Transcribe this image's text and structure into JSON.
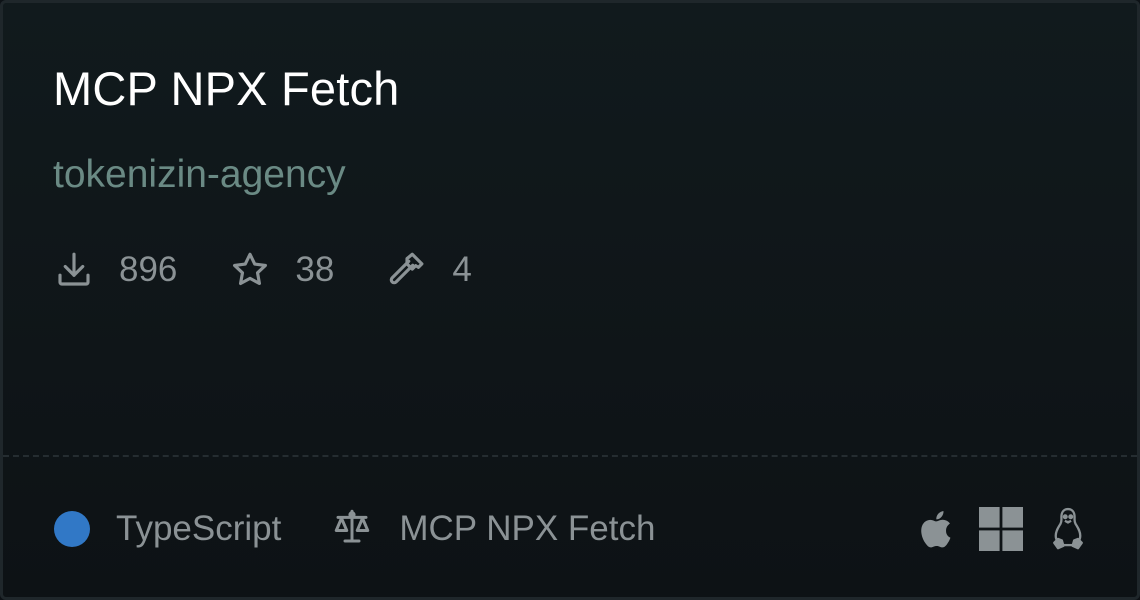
{
  "card": {
    "title": "MCP NPX Fetch",
    "owner": "tokenizin-agency",
    "stats": {
      "downloads": "896",
      "stars": "38",
      "tools": "4"
    },
    "footer": {
      "language": "TypeScript",
      "language_color": "#3178c6",
      "license": "MCP NPX Fetch",
      "platforms": [
        "apple-icon",
        "windows-icon",
        "linux-icon"
      ]
    }
  }
}
